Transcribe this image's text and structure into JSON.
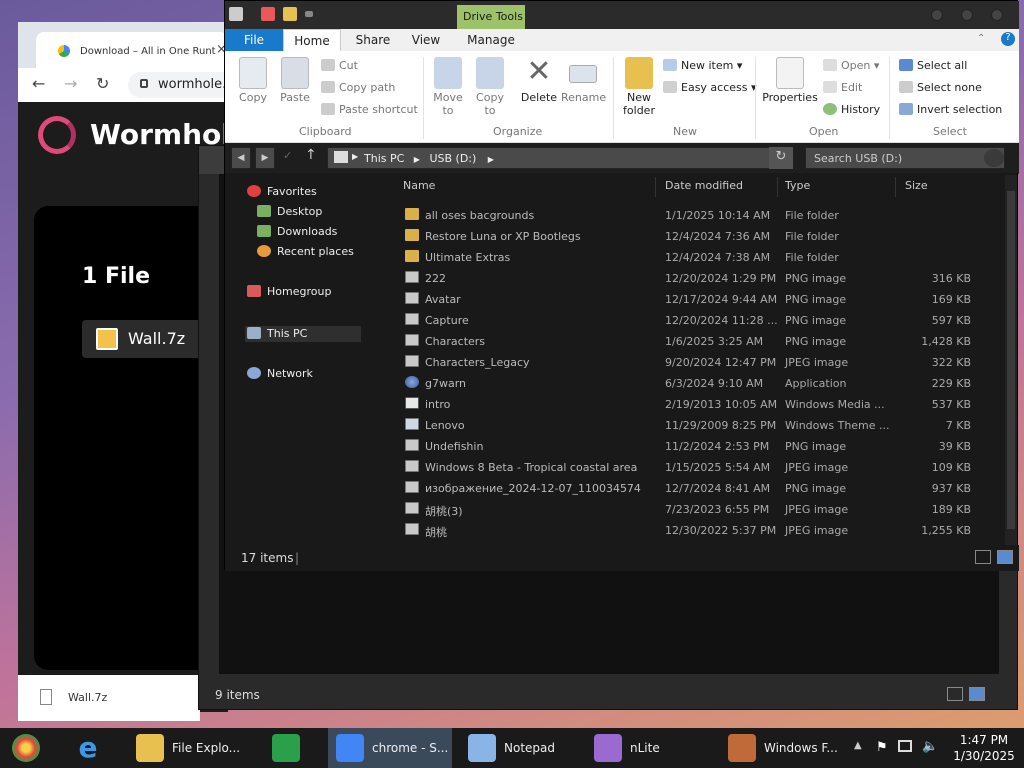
{
  "chrome": {
    "tab_title": "Download – All in One Runt",
    "address": "wormhole.",
    "brand": "Wormhole",
    "file_count": "1 File",
    "file_name": "Wall.7z",
    "download_item": "Wall.7z"
  },
  "explorer_back": {
    "status": "9 items"
  },
  "explorer": {
    "contextual_tab": "Drive Tools",
    "tabs": {
      "file": "File",
      "home": "Home",
      "share": "Share",
      "view": "View",
      "manage": "Manage"
    },
    "ribbon": {
      "copy": "Copy",
      "paste": "Paste",
      "cut": "Cut",
      "copy_path": "Copy path",
      "paste_shortcut": "Paste shortcut",
      "clipboard": "Clipboard",
      "move_to": "Move",
      "move_to2": "to",
      "copy_to": "Copy",
      "copy_to2": "to",
      "delete": "Delete",
      "rename": "Rename",
      "organize": "Organize",
      "new_folder": "New",
      "new_folder2": "folder",
      "new_item": "New item",
      "easy_access": "Easy access",
      "new": "New",
      "properties": "Properties",
      "open": "Open",
      "edit": "Edit",
      "history": "History",
      "open_group": "Open",
      "select_all": "Select all",
      "select_none": "Select none",
      "invert_selection": "Invert selection",
      "select": "Select"
    },
    "address": {
      "this_pc": "This PC",
      "drive": "USB (D:)"
    },
    "search_placeholder": "Search USB (D:)",
    "nav": {
      "favorites": "Favorites",
      "desktop": "Desktop",
      "downloads": "Downloads",
      "recent": "Recent places",
      "homegroup": "Homegroup",
      "this_pc": "This PC",
      "network": "Network"
    },
    "columns": {
      "name": "Name",
      "date": "Date modified",
      "type": "Type",
      "size": "Size"
    },
    "files": [
      {
        "name": "all oses bacgrounds",
        "date": "1/1/2025 10:14 AM",
        "type": "File folder",
        "size": "",
        "icon": "folder"
      },
      {
        "name": "Restore Luna or XP Bootlegs",
        "date": "12/4/2024 7:36 AM",
        "type": "File folder",
        "size": "",
        "icon": "folder"
      },
      {
        "name": "Ultimate Extras",
        "date": "12/4/2024 7:38 AM",
        "type": "File folder",
        "size": "",
        "icon": "folder"
      },
      {
        "name": "222",
        "date": "12/20/2024 1:29 PM",
        "type": "PNG image",
        "size": "316 KB",
        "icon": "png"
      },
      {
        "name": "Avatar",
        "date": "12/17/2024 9:44 AM",
        "type": "PNG image",
        "size": "169 KB",
        "icon": "png"
      },
      {
        "name": "Capture",
        "date": "12/20/2024 11:28 ...",
        "type": "PNG image",
        "size": "597 KB",
        "icon": "png"
      },
      {
        "name": "Characters",
        "date": "1/6/2025 3:25 AM",
        "type": "PNG image",
        "size": "1,428 KB",
        "icon": "png"
      },
      {
        "name": "Characters_Legacy",
        "date": "9/20/2024 12:47 PM",
        "type": "JPEG image",
        "size": "322 KB",
        "icon": "png"
      },
      {
        "name": "g7warn",
        "date": "6/3/2024 9:10 AM",
        "type": "Application",
        "size": "229 KB",
        "icon": "app"
      },
      {
        "name": "intro",
        "date": "2/19/2013 10:05 AM",
        "type": "Windows Media ...",
        "size": "537 KB",
        "icon": "wmv"
      },
      {
        "name": "Lenovo",
        "date": "11/29/2009 8:25 PM",
        "type": "Windows Theme ...",
        "size": "7 KB",
        "icon": "theme"
      },
      {
        "name": "Undefishin",
        "date": "11/2/2024 2:53 PM",
        "type": "PNG image",
        "size": "39 KB",
        "icon": "png"
      },
      {
        "name": "Windows 8 Beta - Tropical coastal area",
        "date": "1/15/2025 5:54 AM",
        "type": "JPEG image",
        "size": "109 KB",
        "icon": "png"
      },
      {
        "name": "изображение_2024-12-07_110034574",
        "date": "12/7/2024 8:41 AM",
        "type": "PNG image",
        "size": "937 KB",
        "icon": "png"
      },
      {
        "name": "胡桃(3)",
        "date": "7/23/2023 6:55 PM",
        "type": "JPEG image",
        "size": "189 KB",
        "icon": "png"
      },
      {
        "name": "胡桃",
        "date": "12/30/2022 5:37 PM",
        "type": "JPEG image",
        "size": "1,255 KB",
        "icon": "png"
      }
    ],
    "status": "17 items"
  },
  "taskbar": {
    "items": [
      {
        "label": "File Explo...",
        "color": "#e8c050"
      },
      {
        "label": "chrome - S...",
        "color": "#4285f4"
      },
      {
        "label": "Notepad",
        "color": "#8ab4e8"
      },
      {
        "label": "nLite",
        "color": "#9a6ad0"
      },
      {
        "label": "Windows F...",
        "color": "#c06a3a"
      }
    ],
    "time": "1:47 PM",
    "date": "1/30/2025"
  }
}
